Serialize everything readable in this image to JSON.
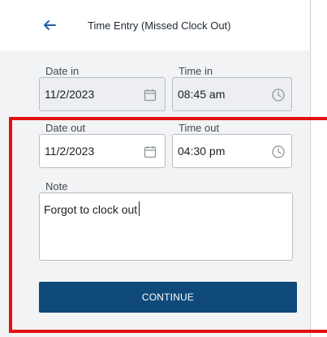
{
  "header": {
    "title": "Time Entry (Missed Clock Out)"
  },
  "date_in": {
    "label": "Date in",
    "value": "11/2/2023"
  },
  "time_in": {
    "label": "Time in",
    "value": "08:45 am"
  },
  "date_out": {
    "label": "Date out",
    "value": "11/2/2023"
  },
  "time_out": {
    "label": "Time out",
    "value": "04:30 pm"
  },
  "note": {
    "label": "Note",
    "value": "Forgot to clock out"
  },
  "actions": {
    "continue_label": "CONTINUE"
  },
  "colors": {
    "primary": "#0f4a7a",
    "accent": "#1f5fa5",
    "highlight": "#e50f0f"
  }
}
